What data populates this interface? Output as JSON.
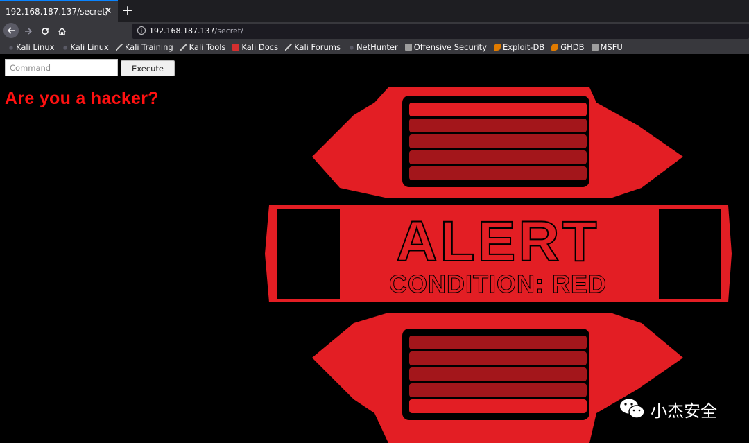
{
  "browser": {
    "tab": {
      "title": "192.168.187.137/secret/",
      "close": "✕"
    },
    "new_tab": "+",
    "url": {
      "host": "192.168.187.137",
      "path": "/secret/"
    },
    "bookmarks": [
      {
        "label": "Kali Linux",
        "icon": "kali-icon"
      },
      {
        "label": "Kali Linux",
        "icon": "kali-icon"
      },
      {
        "label": "Kali Training",
        "icon": "kali-tool-icon"
      },
      {
        "label": "Kali Tools",
        "icon": "kali-tool-icon"
      },
      {
        "label": "Kali Docs",
        "icon": "kali-docs-icon"
      },
      {
        "label": "Kali Forums",
        "icon": "kali-tool-icon"
      },
      {
        "label": "NetHunter",
        "icon": "kali-icon"
      },
      {
        "label": "Offensive Security",
        "icon": "offsec-icon"
      },
      {
        "label": "Exploit-DB",
        "icon": "exploitdb-icon"
      },
      {
        "label": "GHDB",
        "icon": "exploitdb-icon"
      },
      {
        "label": "MSFU",
        "icon": "offsec-icon"
      }
    ]
  },
  "page": {
    "command_input": {
      "placeholder": "Command",
      "value": ""
    },
    "execute_label": "Execute",
    "headline": "Are you a hacker?",
    "graphic": {
      "line1": "ALERT",
      "line2": "CONDITION: RED"
    },
    "colors": {
      "accent_red": "#e31e24",
      "dark_red": "#a3161b",
      "headline_red": "#ff1111"
    }
  },
  "watermark": {
    "text": "小杰安全"
  }
}
